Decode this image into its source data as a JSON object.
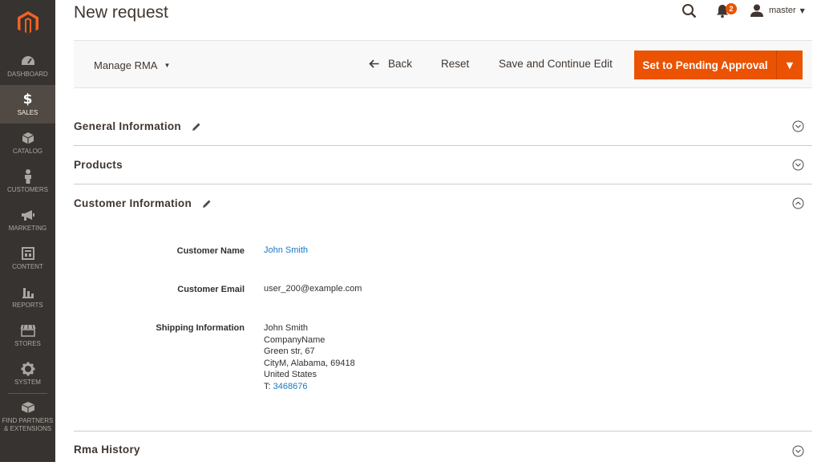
{
  "sidebar": {
    "items": [
      {
        "label": "DASHBOARD",
        "icon": "dashboard-icon"
      },
      {
        "label": "SALES",
        "icon": "dollar-icon"
      },
      {
        "label": "CATALOG",
        "icon": "cube-icon"
      },
      {
        "label": "CUSTOMERS",
        "icon": "person-icon"
      },
      {
        "label": "MARKETING",
        "icon": "megaphone-icon"
      },
      {
        "label": "CONTENT",
        "icon": "layout-icon"
      },
      {
        "label": "REPORTS",
        "icon": "bar-chart-icon"
      },
      {
        "label": "STORES",
        "icon": "storefront-icon"
      },
      {
        "label": "SYSTEM",
        "icon": "gear-icon"
      },
      {
        "label": "FIND PARTNERS & EXTENSIONS",
        "icon": "box-icon"
      }
    ],
    "active": "SALES",
    "icon_dollar": "$"
  },
  "header": {
    "title": "New request",
    "notification_count": "2",
    "user_name": "master"
  },
  "actions": {
    "manage_rma": "Manage RMA",
    "back": "Back",
    "reset": "Reset",
    "save_continue": "Save and Continue Edit",
    "primary": "Set to Pending Approval"
  },
  "sections": {
    "general": "General Information",
    "products": "Products",
    "customer": "Customer Information",
    "rma_history": "Rma History"
  },
  "customer": {
    "name_label": "Customer Name",
    "name_value": "John Smith",
    "email_label": "Customer Email",
    "email_value": "user_200@example.com",
    "shipping_label": "Shipping Information",
    "shipping_lines": [
      "John Smith",
      "CompanyName",
      "Green str, 67",
      "CityM, Alabama, 69418",
      "United States"
    ],
    "phone_prefix": "T: ",
    "phone": "3468676"
  },
  "colors": {
    "accent": "#eb5202",
    "sidebar": "#373330",
    "link": "#1979c3"
  }
}
